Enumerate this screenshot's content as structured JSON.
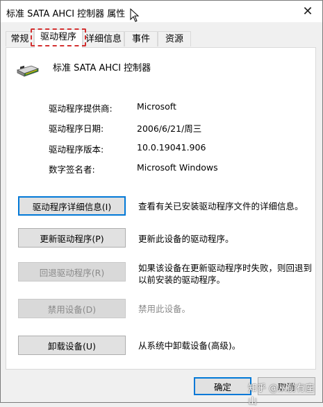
{
  "window": {
    "title": "标准 SATA AHCI 控制器 属性",
    "close": "✕"
  },
  "tabs": [
    {
      "label": "常规",
      "active": false
    },
    {
      "label": "驱动程序",
      "active": true
    },
    {
      "label": "详细信息",
      "active": false
    },
    {
      "label": "事件",
      "active": false
    },
    {
      "label": "资源",
      "active": false
    }
  ],
  "device": {
    "name": "标准 SATA AHCI 控制器",
    "icon": "storage-controller-icon"
  },
  "info": [
    {
      "label": "驱动程序提供商:",
      "value": "Microsoft"
    },
    {
      "label": "驱动程序日期:",
      "value": "2006/6/21/周三"
    },
    {
      "label": "驱动程序版本:",
      "value": "10.0.19041.906"
    },
    {
      "label": "数字签名者:",
      "value": "Microsoft Windows"
    }
  ],
  "actions": [
    {
      "button": "驱动程序详细信息(I)",
      "desc": "查看有关已安装驱动程序文件的详细信息。",
      "enabled": true
    },
    {
      "button": "更新驱动程序(P)",
      "desc": "更新此设备的驱动程序。",
      "enabled": true
    },
    {
      "button": "回退驱动程序(R)",
      "desc": "如果该设备在更新驱动程序时失败，则回退到以前安装的驱动程序。",
      "enabled": false
    },
    {
      "button": "禁用设备(D)",
      "desc": "禁用此设备。",
      "enabled": false
    },
    {
      "button": "卸载设备(U)",
      "desc": "从系统中卸载设备(高级)。",
      "enabled": true
    }
  ],
  "footer": {
    "ok": "确定",
    "cancel": "取消"
  },
  "watermark": "知乎 @从前有座山",
  "colors": {
    "focus": "#0078d7",
    "highlight": "#d32f2f"
  }
}
